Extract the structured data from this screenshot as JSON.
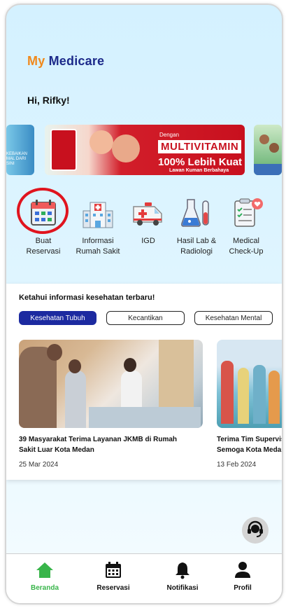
{
  "header": {
    "brand_my": "My",
    "brand_medicare": "Medicare",
    "greeting": "Hi, Rifky!"
  },
  "banners": [
    {
      "name": "banner-left",
      "text": "KEBAIKAN MAL DARI SINI"
    },
    {
      "name": "banner-lifebuoy",
      "intro": "Dengan",
      "title": "MULTIVITAMIN",
      "claim": "100% Lebih Kuat",
      "tagline": "Lawan Kuman Berbahaya"
    },
    {
      "name": "banner-right"
    }
  ],
  "menu": {
    "items": [
      {
        "label_line1": "Buat",
        "label_line2": "Reservasi",
        "icon": "calendar-icon"
      },
      {
        "label_line1": "Informasi",
        "label_line2": "Rumah Sakit",
        "icon": "hospital-icon"
      },
      {
        "label_line1": "IGD",
        "label_line2": "",
        "icon": "ambulance-icon"
      },
      {
        "label_line1": "Hasil Lab &",
        "label_line2": "Radiologi",
        "icon": "lab-flask-icon"
      },
      {
        "label_line1": "Medical",
        "label_line2": "Check-Up",
        "icon": "clipboard-heart-icon"
      }
    ]
  },
  "health_info": {
    "title": "Ketahui informasi kesehatan terbaru!",
    "categories": [
      {
        "label": "Kesehatan Tubuh",
        "active": true
      },
      {
        "label": "Kecantikan",
        "active": false
      },
      {
        "label": "Kesehatan Mental",
        "active": false
      }
    ],
    "articles": [
      {
        "headline_line1": "39 Masyarakat Terima Layanan JKMB di Rumah",
        "headline_line2": "Sakit Luar Kota Medan",
        "date": "25 Mar 2024"
      },
      {
        "headline_line1": "Terima Tim Supervisi",
        "headline_line2": "Semoga Kota Medan",
        "date": "13 Feb 2024"
      }
    ]
  },
  "support": {
    "icon": "headset-icon"
  },
  "tabbar": {
    "tabs": [
      {
        "label": "Beranda",
        "icon": "home-icon",
        "active": true
      },
      {
        "label": "Reservasi",
        "icon": "calendar-icon",
        "active": false
      },
      {
        "label": "Notifikasi",
        "icon": "bell-icon",
        "active": false
      },
      {
        "label": "Profil",
        "icon": "user-icon",
        "active": false
      }
    ]
  },
  "colors": {
    "brand_orange": "#f0891c",
    "brand_navy": "#1c2a8a",
    "active_green": "#38b54a",
    "pill_active": "#1c2aa0",
    "highlight_red": "#e0141e"
  }
}
